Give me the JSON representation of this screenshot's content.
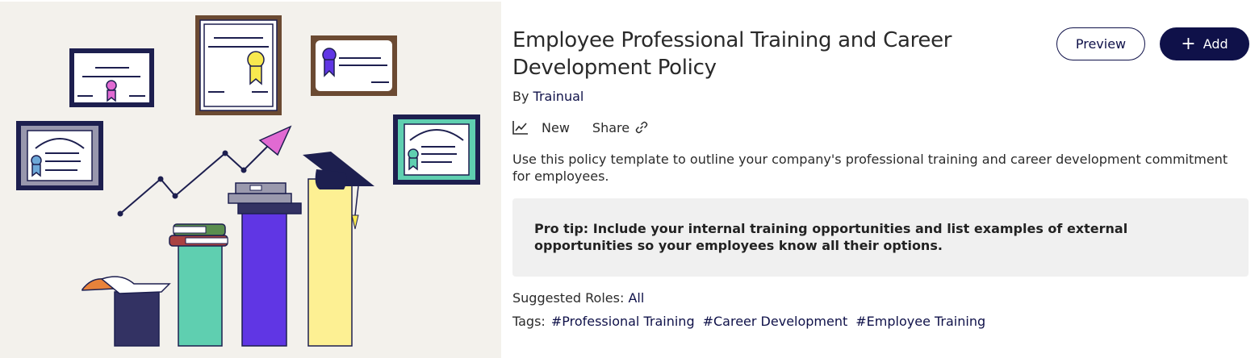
{
  "template": {
    "title": "Employee Professional Training and Career Development Policy",
    "by_prefix": "By",
    "author": "Trainual",
    "status_label": "New",
    "share_label": "Share",
    "description": "Use this policy template to outline your company's professional training and career development commitment for employees.",
    "pro_tip": "Pro tip: Include your internal training opportunities and list examples of external opportunities so your employees know all their options.",
    "roles_label": "Suggested Roles:",
    "roles_value": "All",
    "tags_label": "Tags:",
    "tags": [
      "#Professional Training",
      "#Career Development",
      "#Employee Training"
    ]
  },
  "actions": {
    "preview_label": "Preview",
    "add_label": "Add",
    "add_icon": "plus-icon"
  },
  "icons": {
    "status": "trend-chart-icon",
    "share": "link-icon"
  },
  "colors": {
    "brand_navy": "#0f1149",
    "hero_background": "#f3f1ec",
    "tip_background": "#f0f0f0",
    "bar_navy": "#333263",
    "bar_teal": "#5fcfb0",
    "bar_purple": "#6036e4",
    "bar_yellow": "#fdf093",
    "arrow_pink": "#e16ad2"
  }
}
